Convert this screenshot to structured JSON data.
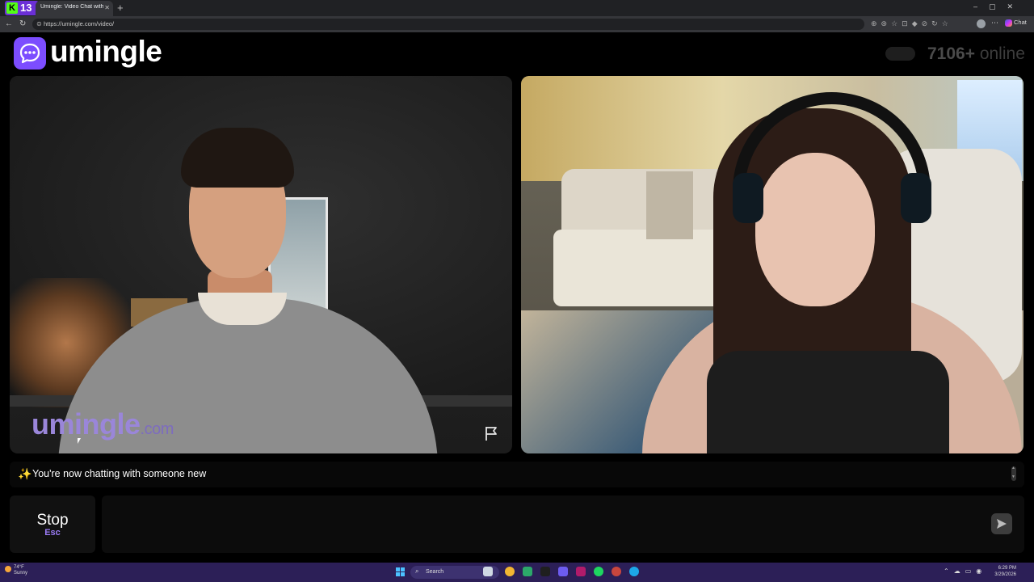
{
  "browser": {
    "kick_badge_count": "13",
    "tab_title": "Umingle: Video Chat with Str...",
    "url": "https://umingle.com/video/",
    "copilot_label": "Chat"
  },
  "header": {
    "logo_text": "umingle",
    "online_count": "7106+",
    "online_label": "online"
  },
  "video": {
    "watermark_main": "umingle",
    "watermark_suffix": ".com"
  },
  "chat": {
    "status_icon": "sparkles-icon",
    "status_message": "You're now chatting with someone new",
    "stop_label": "Stop",
    "stop_shortcut": "Esc",
    "message_placeholder": ""
  },
  "taskbar": {
    "weather_temp": "74°F",
    "weather_desc": "Sunny",
    "search_label": "Search",
    "time": "6:29 PM",
    "date": "3/29/2026"
  },
  "colors": {
    "brand": "#7c4dff",
    "stop_shortcut": "#9b7cf7",
    "background": "#000000"
  }
}
